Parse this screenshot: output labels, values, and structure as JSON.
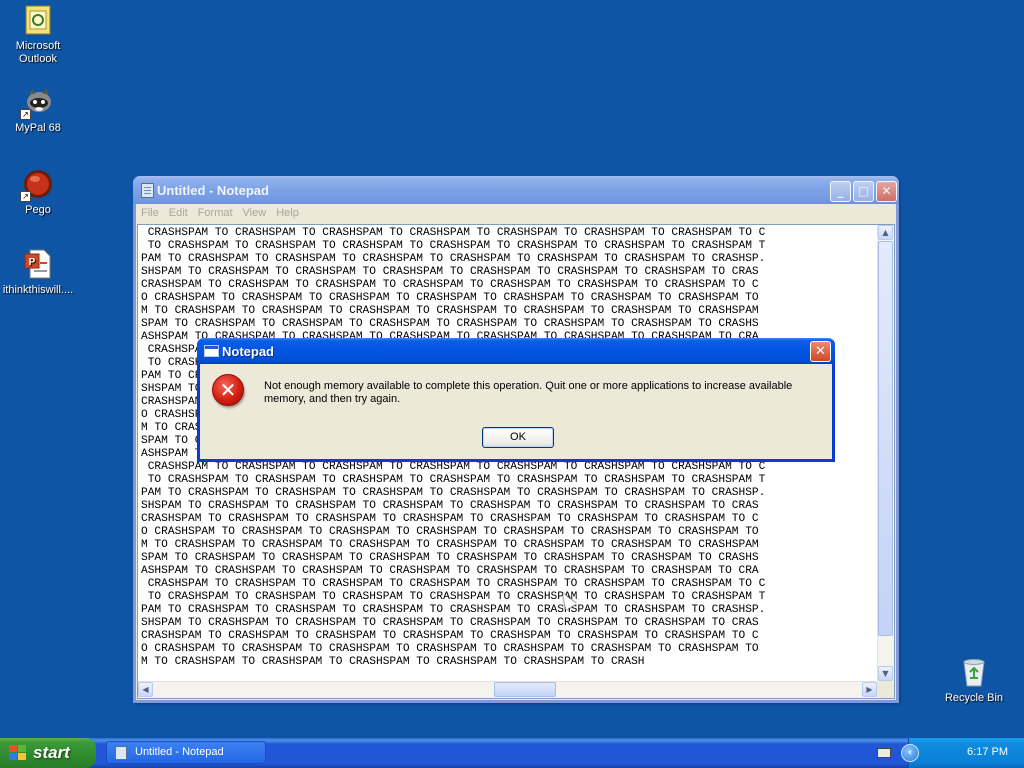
{
  "desktop": {
    "icons": [
      {
        "label_line1": "Microsoft",
        "label_line2": "Outlook"
      },
      {
        "label_line1": "MyPal 68",
        "label_line2": ""
      },
      {
        "label_line1": "Pego",
        "label_line2": ""
      },
      {
        "label_line1": "ithinkthiswill....",
        "label_line2": ""
      }
    ],
    "recycle_bin_label": "Recycle Bin"
  },
  "notepad": {
    "title": "Untitled - Notepad",
    "menu": [
      "File",
      "Edit",
      "Format",
      "View",
      "Help"
    ],
    "lines": [
      " CRASHSPAM TO CRASHSPAM TO CRASHSPAM TO CRASHSPAM TO CRASHSPAM TO CRASHSPAM TO CRASHSPAM TO C",
      " TO CRASHSPAM TO CRASHSPAM TO CRASHSPAM TO CRASHSPAM TO CRASHSPAM TO CRASHSPAM TO CRASHSPAM T",
      "PAM TO CRASHSPAM TO CRASHSPAM TO CRASHSPAM TO CRASHSPAM TO CRASHSPAM TO CRASHSPAM TO CRASHSP.",
      "SHSPAM TO CRASHSPAM TO CRASHSPAM TO CRASHSPAM TO CRASHSPAM TO CRASHSPAM TO CRASHSPAM TO CRAS",
      "CRASHSPAM TO CRASHSPAM TO CRASHSPAM TO CRASHSPAM TO CRASHSPAM TO CRASHSPAM TO CRASHSPAM TO C",
      "O CRASHSPAM TO CRASHSPAM TO CRASHSPAM TO CRASHSPAM TO CRASHSPAM TO CRASHSPAM TO CRASHSPAM TO",
      "M TO CRASHSPAM TO CRASHSPAM TO CRASHSPAM TO CRASHSPAM TO CRASHSPAM TO CRASHSPAM TO CRASHSPAM",
      "SPAM TO CRASHSPAM TO CRASHSPAM TO CRASHSPAM TO CRASHSPAM TO CRASHSPAM TO CRASHSPAM TO CRASHS",
      "ASHSPAM TO CRASHSPAM TO CRASHSPAM TO CRASHSPAM TO CRASHSPAM TO CRASHSPAM TO CRASHSPAM TO CRA",
      " CRASHSPAM TO CRASHSPAM TO CRASHSPAM TO CRASHSPAM TO CRASHSPAM TO CRASHSPAM TO CRASHSPAM TO C",
      " TO CRASHSPAM TO CRASHSPAM TO CRASHSPAM TO CRASHSPAM TO CRASHSPAM TO CRASHSPAM TO CRASHSPAM T",
      "PAM TO CRASHSPAM TO CRASHSPAM TO CRASHSPAM TO CRASHSPAM TO CRASHSPAM TO CRASHSPAM TO CRASHSP.",
      "SHSPAM TO CRASHSPAM TO CRASHSPAM TO CRASHSPAM TO CRASHSPAM TO CRASHSPAM TO CRASHSPAM TO CRAS",
      "CRASHSPAM TO CRASHSPAM TO CRASHSPAM TO CRASHSPAM TO CRASHSPAM TO CRASHSPAM TO CRASHSPAM TO C",
      "O CRASHSPAM TO CRASHSPAM TO CRASHSPAM TO CRASHSPAM TO CRASHSPAM TO CRASHSPAM TO CRASHSPAM TO",
      "M TO CRASHSPAM TO CRASHSPAM TO CRASHSPAM TO CRASHSPAM TO CRASHSPAM TO CRASHSPAM TO CRASHSPAM",
      "SPAM TO CRASHSPAM TO CRASHSPAM TO CRASHSPAM TO CRASHSPAM TO CRASHSPAM TO CRASHSPAM TO CRASHS",
      "ASHSPAM TO CRASHSPAM TO CRASHSPAM TO CRASHSPAM TO CRASHSPAM TO CRASHSPAM TO CRASHSPAM TO CRA",
      " CRASHSPAM TO CRASHSPAM TO CRASHSPAM TO CRASHSPAM TO CRASHSPAM TO CRASHSPAM TO CRASHSPAM TO C",
      " TO CRASHSPAM TO CRASHSPAM TO CRASHSPAM TO CRASHSPAM TO CRASHSPAM TO CRASHSPAM TO CRASHSPAM T",
      "PAM TO CRASHSPAM TO CRASHSPAM TO CRASHSPAM TO CRASHSPAM TO CRASHSPAM TO CRASHSPAM TO CRASHSP.",
      "SHSPAM TO CRASHSPAM TO CRASHSPAM TO CRASHSPAM TO CRASHSPAM TO CRASHSPAM TO CRASHSPAM TO CRAS",
      "CRASHSPAM TO CRASHSPAM TO CRASHSPAM TO CRASHSPAM TO CRASHSPAM TO CRASHSPAM TO CRASHSPAM TO C",
      "O CRASHSPAM TO CRASHSPAM TO CRASHSPAM TO CRASHSPAM TO CRASHSPAM TO CRASHSPAM TO CRASHSPAM TO",
      "M TO CRASHSPAM TO CRASHSPAM TO CRASHSPAM TO CRASHSPAM TO CRASHSPAM TO CRASHSPAM TO CRASHSPAM",
      "SPAM TO CRASHSPAM TO CRASHSPAM TO CRASHSPAM TO CRASHSPAM TO CRASHSPAM TO CRASHSPAM TO CRASHS",
      "ASHSPAM TO CRASHSPAM TO CRASHSPAM TO CRASHSPAM TO CRASHSPAM TO CRASHSPAM TO CRASHSPAM TO CRA",
      " CRASHSPAM TO CRASHSPAM TO CRASHSPAM TO CRASHSPAM TO CRASHSPAM TO CRASHSPAM TO CRASHSPAM TO C",
      " TO CRASHSPAM TO CRASHSPAM TO CRASHSPAM TO CRASHSPAM TO CRASHSPAM TO CRASHSPAM TO CRASHSPAM T",
      "PAM TO CRASHSPAM TO CRASHSPAM TO CRASHSPAM TO CRASHSPAM TO CRASHSPAM TO CRASHSPAM TO CRASHSP.",
      "SHSPAM TO CRASHSPAM TO CRASHSPAM TO CRASHSPAM TO CRASHSPAM TO CRASHSPAM TO CRASHSPAM TO CRAS",
      "CRASHSPAM TO CRASHSPAM TO CRASHSPAM TO CRASHSPAM TO CRASHSPAM TO CRASHSPAM TO CRASHSPAM TO C",
      "O CRASHSPAM TO CRASHSPAM TO CRASHSPAM TO CRASHSPAM TO CRASHSPAM TO CRASHSPAM TO CRASHSPAM TO",
      "M TO CRASHSPAM TO CRASHSPAM TO CRASHSPAM TO CRASHSPAM TO CRASHSPAM TO CRASH"
    ]
  },
  "dialog": {
    "title": "Notepad",
    "message": "Not enough memory available to complete this operation. Quit one or more applications to increase available memory, and then try again.",
    "ok_label": "OK",
    "icon": "error-icon"
  },
  "taskbar": {
    "start_label": "start",
    "task_label": "Untitled - Notepad",
    "clock": "6:17 PM"
  },
  "colors": {
    "desktop": "#0f55a6",
    "dialog_title": "#0455e3",
    "inactive_title": "#7da2e6",
    "start_green": "#3c9a3a"
  }
}
